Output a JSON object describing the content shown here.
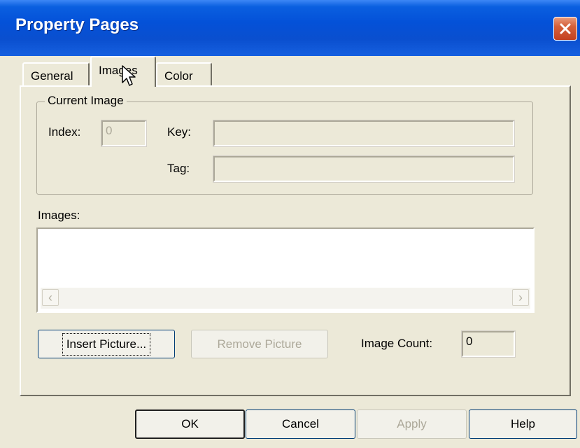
{
  "window": {
    "title": "Property Pages"
  },
  "tabs": [
    {
      "label": "General",
      "selected": false
    },
    {
      "label": "Images",
      "selected": true
    },
    {
      "label": "Color",
      "selected": false
    }
  ],
  "current_image": {
    "group_label": "Current Image",
    "index_label": "Index:",
    "index_value": "0",
    "key_label": "Key:",
    "key_value": "",
    "tag_label": "Tag:",
    "tag_value": ""
  },
  "images_list": {
    "label": "Images:",
    "items": []
  },
  "actions": {
    "insert_label": "Insert Picture...",
    "remove_label": "Remove Picture",
    "image_count_label": "Image Count:",
    "image_count_value": "0"
  },
  "dialog_buttons": {
    "ok_label": "OK",
    "cancel_label": "Cancel",
    "apply_label": "Apply",
    "help_label": "Help"
  },
  "colors": {
    "title_bar": "#0451d8",
    "dialog_face": "#ece9d8",
    "close_button": "#d5603a",
    "disabled_text": "#aca899"
  }
}
